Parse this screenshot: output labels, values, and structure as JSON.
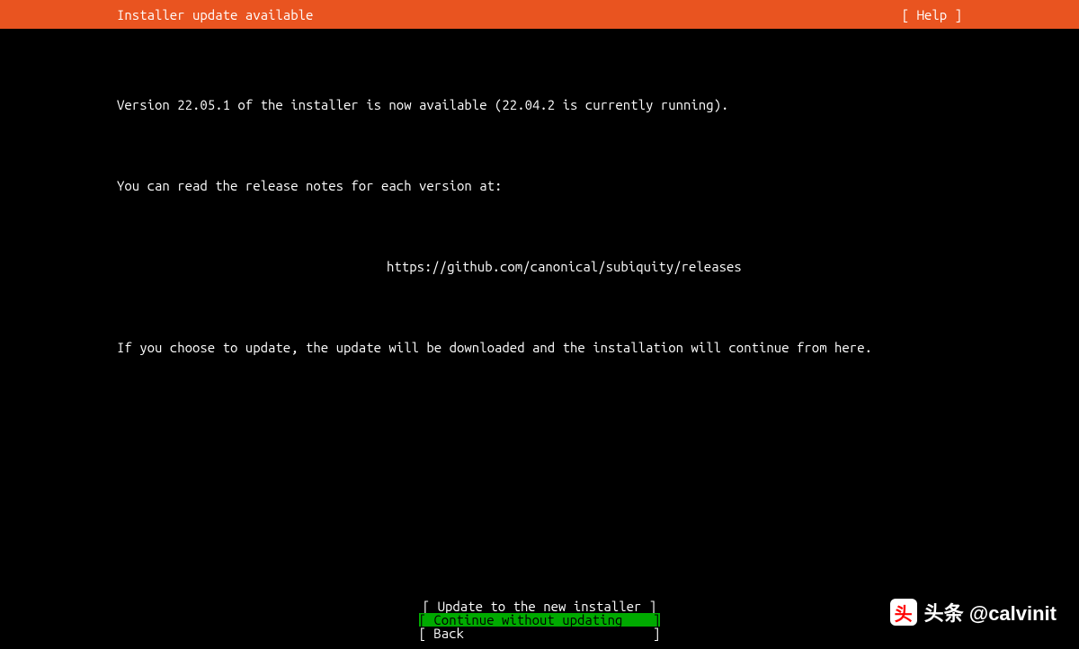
{
  "header": {
    "title": "Installer update available",
    "help": "[ Help ]"
  },
  "body": {
    "line1": "Version 22.05.1 of the installer is now available (22.04.2 is currently running).",
    "line2": "You can read the release notes for each version at:",
    "url": "https://github.com/canonical/subiquity/releases",
    "line3": "If you choose to update, the update will be downloaded and the installation will continue from here."
  },
  "buttons": {
    "update": "[ Update to the new installer ]",
    "continue": "[ Continue without updating    ]",
    "back": "[ Back                         ]"
  },
  "watermark": {
    "logo": "头",
    "text": "头条 @calvinit"
  }
}
